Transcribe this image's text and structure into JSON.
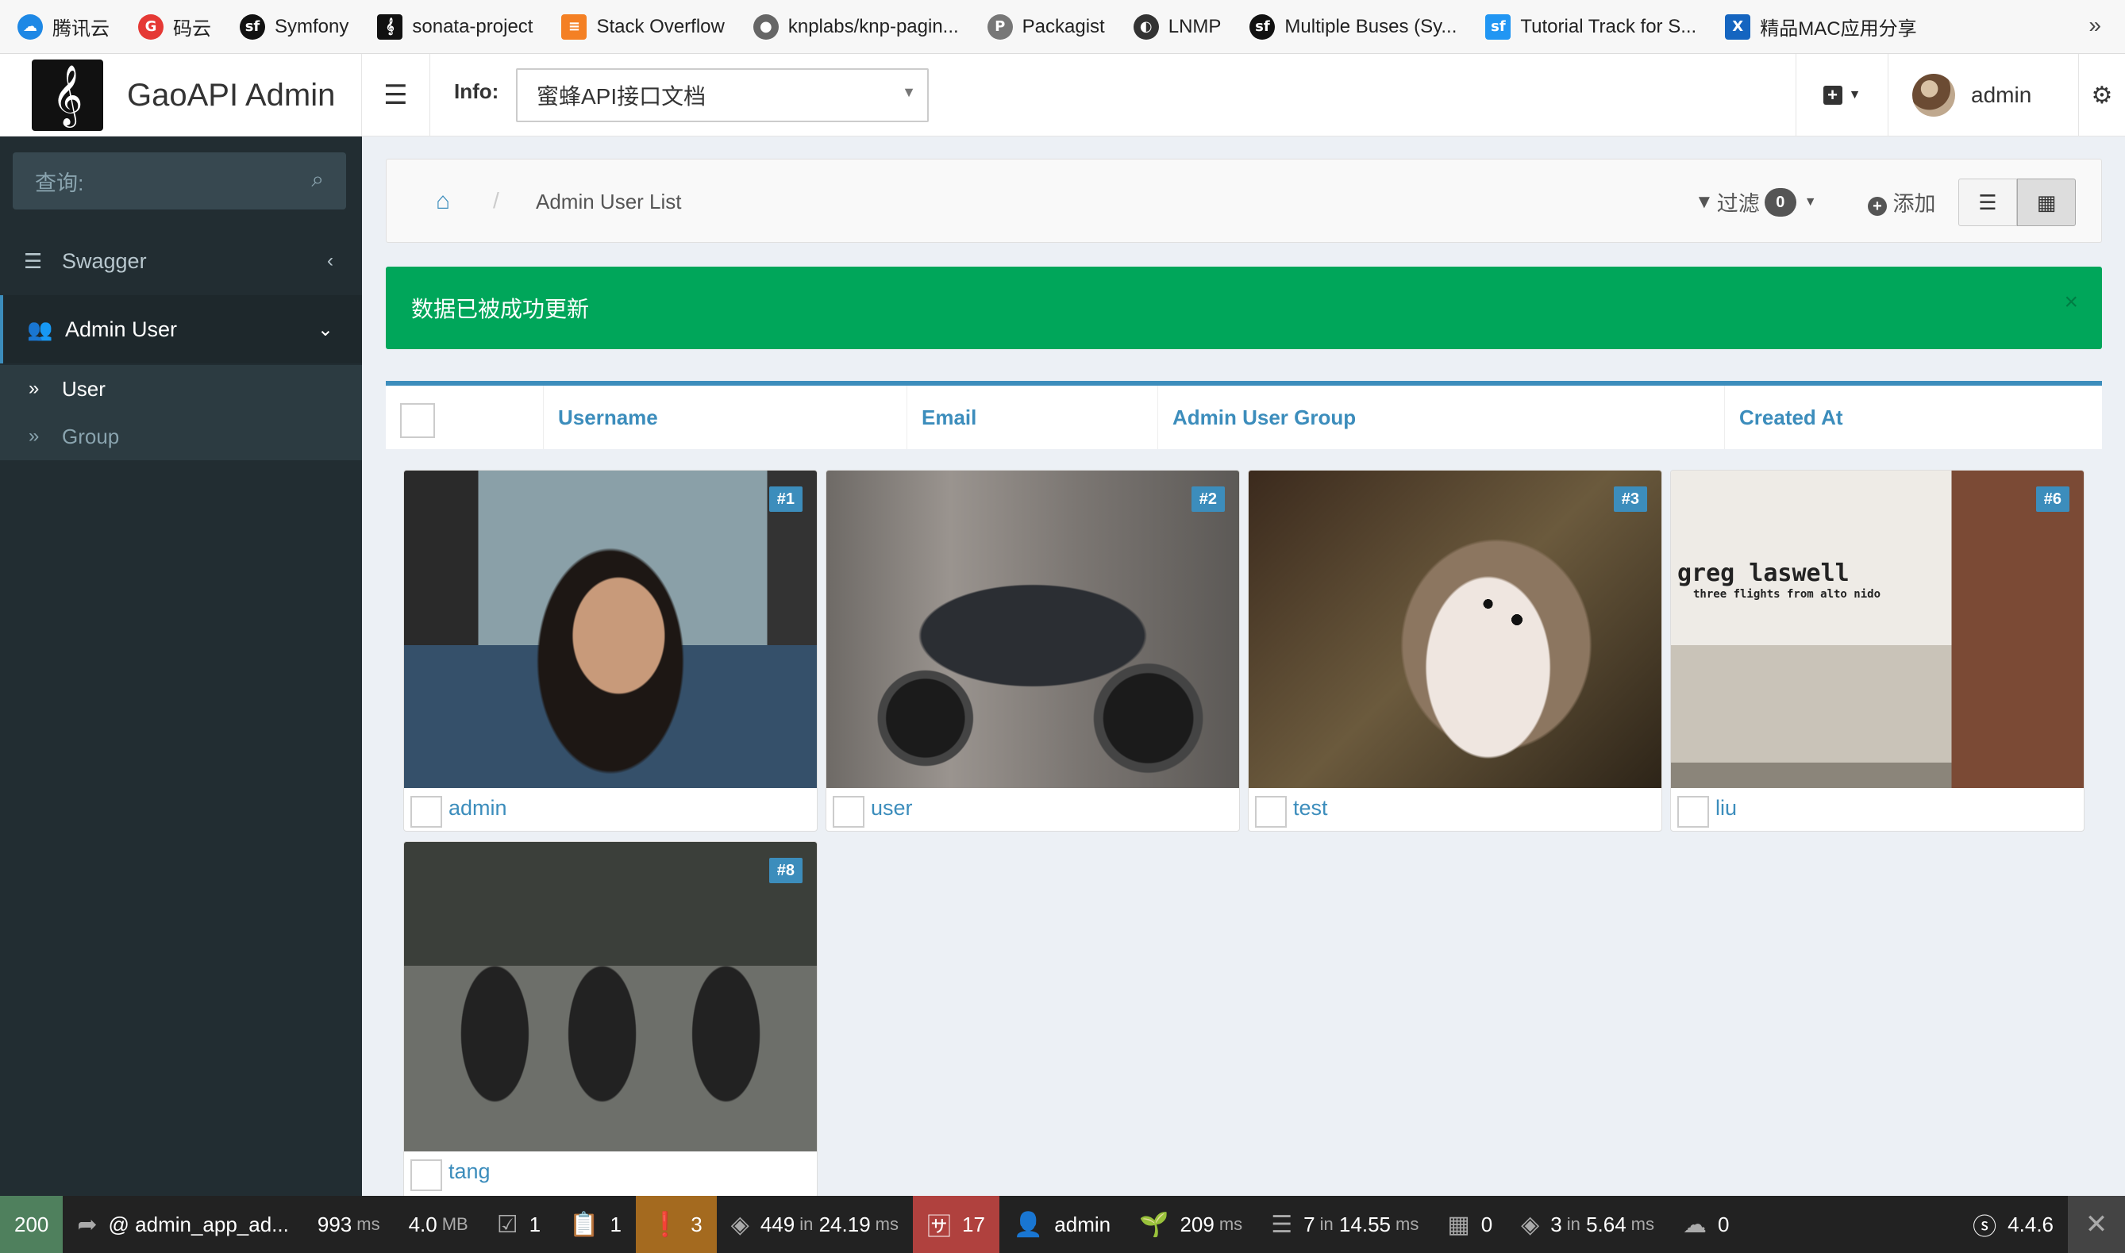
{
  "bookmarks": [
    {
      "label": "腾讯云",
      "icon": "cloud-icon",
      "color": "#1e88e5"
    },
    {
      "label": "码云",
      "icon": "gitee-icon",
      "color": "#e53935"
    },
    {
      "label": "Symfony",
      "icon": "symfony-icon",
      "color": "#111111"
    },
    {
      "label": "sonata-project",
      "icon": "sonata-icon",
      "color": "#111111"
    },
    {
      "label": "Stack Overflow",
      "icon": "stackoverflow-icon",
      "color": "#f48024"
    },
    {
      "label": "knplabs/knp-pagin...",
      "icon": "github-icon",
      "color": "#555555"
    },
    {
      "label": "Packagist",
      "icon": "packagist-icon",
      "color": "#555555"
    },
    {
      "label": "LNMP",
      "icon": "lnmp-icon",
      "color": "#333333"
    },
    {
      "label": "Multiple Buses (Sy...",
      "icon": "symfony-icon",
      "color": "#111111"
    },
    {
      "label": "Tutorial Track for S...",
      "icon": "sf-casts-icon",
      "color": "#2196f3"
    },
    {
      "label": "精品MAC应用分享",
      "icon": "xmac-icon",
      "color": "#1565c0"
    }
  ],
  "bookmarks_more": "»",
  "header": {
    "app_title": "GaoAPI Admin",
    "info_label": "Info:",
    "info_select_value": "蜜蜂API接口文档",
    "user_name": "admin"
  },
  "sidebar": {
    "search_placeholder": "查询:",
    "items": [
      {
        "label": "Swagger",
        "icon": "list-icon"
      },
      {
        "label": "Admin User",
        "icon": "users-icon"
      }
    ],
    "subitems": [
      {
        "label": "User"
      },
      {
        "label": "Group"
      }
    ]
  },
  "breadcrumb": {
    "current": "Admin User List"
  },
  "actions": {
    "filter_label": "过滤",
    "filter_count": "0",
    "add_label": "添加"
  },
  "alert": {
    "message": "数据已被成功更新"
  },
  "table": {
    "columns": [
      "Username",
      "Email",
      "Admin User Group",
      "Created At"
    ]
  },
  "cards": [
    {
      "id": "#1",
      "name": "admin"
    },
    {
      "id": "#2",
      "name": "user"
    },
    {
      "id": "#3",
      "name": "test"
    },
    {
      "id": "#6",
      "name": "liu"
    },
    {
      "id": "#8",
      "name": "tang"
    }
  ],
  "album_text": {
    "line1": "greg laswell",
    "line2": "three flights from alto nido"
  },
  "debugbar": {
    "status": "200",
    "route": "@ admin_app_ad...",
    "time": "993",
    "time_unit": "ms",
    "memory": "4.0",
    "memory_unit": "MB",
    "forms": "1",
    "logs": "1",
    "warnings": "3",
    "events": "449",
    "events_in": "in",
    "events_time": "24.19",
    "events_unit": "ms",
    "translations": "17",
    "security_user": "admin",
    "twig_time": "209",
    "twig_unit": "ms",
    "db_queries": "7",
    "db_in": "in",
    "db_time": "14.55",
    "db_unit": "ms",
    "widgets": "0",
    "cache": "3",
    "cache_in": "in",
    "cache_time": "5.64",
    "cache_unit": "ms",
    "http_client": "0",
    "symfony_version": "4.4.6"
  }
}
